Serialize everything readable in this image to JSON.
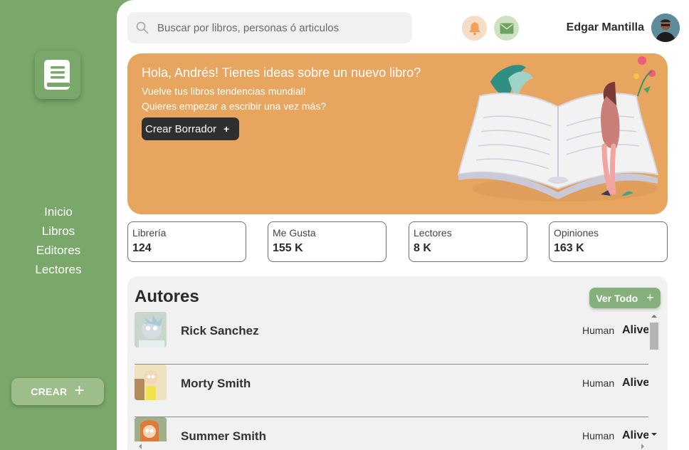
{
  "sidebar": {
    "logo_icon": "book-icon",
    "nav": [
      {
        "label": "Inicio"
      },
      {
        "label": "Libros"
      },
      {
        "label": "Editores"
      },
      {
        "label": "Lectores"
      }
    ],
    "create_label": "CREAR",
    "create_icon": "plus-icon"
  },
  "header": {
    "search_placeholder": "Buscar por libros, personas ó articulos",
    "search_icon": "search-icon",
    "notification_icon": "bell-icon",
    "messages_icon": "mail-icon",
    "user_name": "Edgar Mantilla"
  },
  "hero": {
    "title": "Hola, Andrés! Tienes ideas sobre un nuevo libro?",
    "line1": "Vuelve tus libros tendencias mundial!",
    "line2": "Quieres empezar a escribir una vez más?",
    "button_label": "Crear Borrador",
    "button_icon": "+"
  },
  "stats": [
    {
      "label": "Librería",
      "value": "124"
    },
    {
      "label": "Me Gusta",
      "value": "155 K"
    },
    {
      "label": "Lectores",
      "value": "8 K"
    },
    {
      "label": "Opiniones",
      "value": "163 K"
    }
  ],
  "authors": {
    "title": "Autores",
    "view_all_label": "Ver Todo",
    "view_all_icon": "+",
    "items": [
      {
        "name": "Rick Sanchez",
        "species": "Human",
        "status": "Alive"
      },
      {
        "name": "Morty Smith",
        "species": "Human",
        "status": "Alive"
      },
      {
        "name": "Summer Smith",
        "species": "Human",
        "status": "Alive"
      }
    ]
  },
  "colors": {
    "sidebar": "#7aa86a",
    "hero": "#e8a55f",
    "accent_green": "#86b07b",
    "dark_button": "#2f2f2f"
  }
}
